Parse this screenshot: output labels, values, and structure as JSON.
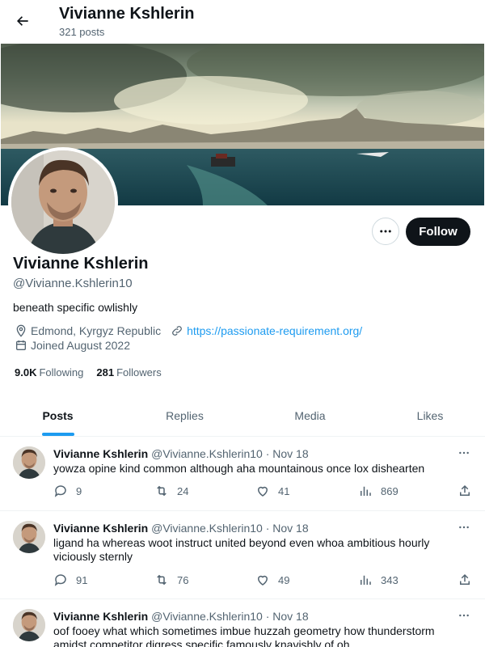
{
  "header": {
    "title": "Vivianne Kshlerin",
    "subtitle": "321 posts"
  },
  "profile": {
    "display_name": "Vivianne Kshlerin",
    "handle": "@Vivianne.Kshlerin10",
    "bio": "beneath specific owlishly",
    "location": "Edmond, Kyrgyz Republic",
    "website": "https://passionate-requirement.org/",
    "joined": "Joined August 2022",
    "following_count": "9.0K",
    "following_label": "Following",
    "followers_count": "281",
    "followers_label": "Followers",
    "follow_label": "Follow"
  },
  "tabs": [
    {
      "label": "Posts",
      "active": true
    },
    {
      "label": "Replies"
    },
    {
      "label": "Media"
    },
    {
      "label": "Likes"
    }
  ],
  "posts": [
    {
      "name": "Vivianne Kshlerin",
      "handle": "@Vivianne.Kshlerin10",
      "date": "· Nov 18",
      "text": "yowza opine kind common although aha mountainous once lox dishearten",
      "replies": "9",
      "reposts": "24",
      "likes": "41",
      "views": "869"
    },
    {
      "name": "Vivianne Kshlerin",
      "handle": "@Vivianne.Kshlerin10",
      "date": "· Nov 18",
      "text": "ligand ha whereas woot instruct united beyond even whoa ambitious hourly viciously sternly",
      "replies": "91",
      "reposts": "76",
      "likes": "49",
      "views": "343"
    },
    {
      "name": "Vivianne Kshlerin",
      "handle": "@Vivianne.Kshlerin10",
      "date": "· Nov 18",
      "text": "oof fooey what which sometimes imbue huzzah geometry how thunderstorm amidst competitor digress specific famously knavishly of oh",
      "replies": "",
      "reposts": "",
      "likes": "",
      "views": ""
    }
  ],
  "colors": {
    "accent": "#1d9bf0",
    "text": "#0f1419",
    "muted": "#536471",
    "border": "#eff3f4"
  }
}
